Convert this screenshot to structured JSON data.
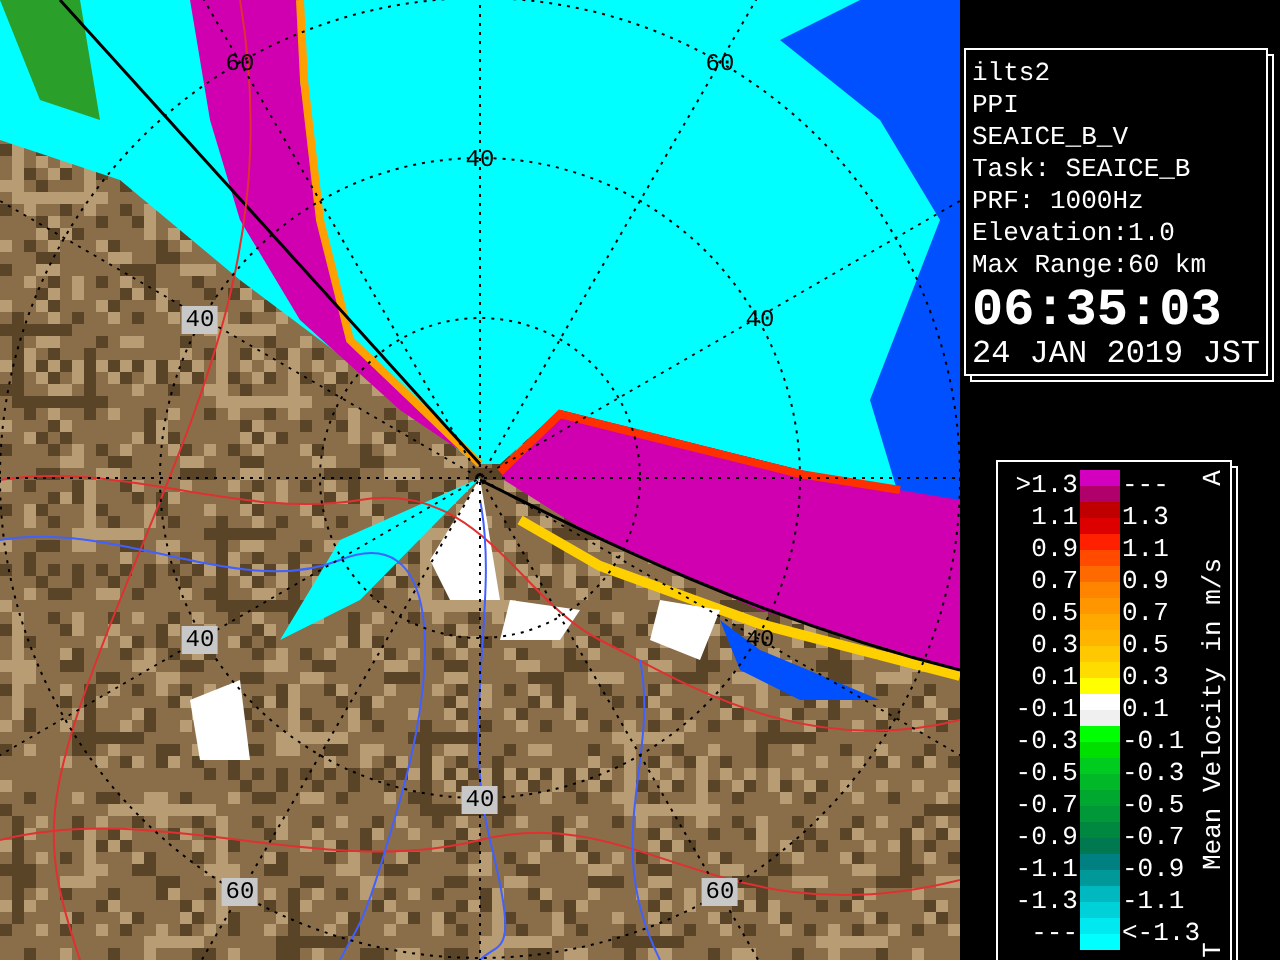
{
  "map": {
    "range_labels": [
      {
        "text": "60",
        "kind": "plain"
      },
      {
        "text": "60",
        "kind": "plain"
      },
      {
        "text": "40",
        "kind": "plain"
      },
      {
        "text": "40",
        "kind": "boxed"
      },
      {
        "text": "40",
        "kind": "plain"
      },
      {
        "text": "40",
        "kind": "boxed"
      },
      {
        "text": "40",
        "kind": "plain"
      },
      {
        "text": "40",
        "kind": "boxed"
      },
      {
        "text": "60",
        "kind": "boxed"
      },
      {
        "text": "60",
        "kind": "boxed"
      }
    ]
  },
  "info": {
    "lines": [
      "ilts2",
      "PPI",
      "SEAICE_B_V",
      "Task: SEAICE_B",
      "PRF: 1000Hz",
      "Elevation:1.0",
      "Max Range:60 km"
    ],
    "time": "06:35:03",
    "date": "24 JAN 2019 JST"
  },
  "legend": {
    "top_mark": "A",
    "title": "Mean Velocity in m/s",
    "bottom_mark": "T",
    "left_labels": [
      ">1.3",
      "1.1",
      "0.9",
      "0.7",
      "0.5",
      "0.3",
      "0.1",
      "-0.1",
      "-0.3",
      "-0.5",
      "-0.7",
      "-0.9",
      "-1.1",
      "-1.3",
      "---"
    ],
    "right_labels": [
      "---",
      "1.3",
      "1.1",
      "0.9",
      "0.7",
      "0.5",
      "0.3",
      "0.1",
      "-0.1",
      "-0.3",
      "-0.5",
      "-0.7",
      "-0.9",
      "-1.1",
      "<-1.3"
    ],
    "swatches": [
      {
        "color": "#d400c0"
      },
      {
        "color": "#b0006a"
      },
      {
        "color": "#c00000"
      },
      {
        "color": "#dc0000"
      },
      {
        "color": "#ff2000"
      },
      {
        "color": "#ff4a00"
      },
      {
        "color": "#ff6a00"
      },
      {
        "color": "#ff8400"
      },
      {
        "color": "#ff9600"
      },
      {
        "color": "#ffa800"
      },
      {
        "color": "#ffb400"
      },
      {
        "color": "#ffc800"
      },
      {
        "color": "#ffdc00"
      },
      {
        "color": "#ffff00"
      },
      {
        "color": "#ffffff"
      },
      {
        "color": "#f0f0f0"
      },
      {
        "color": "#00ff00"
      },
      {
        "color": "#00e000"
      },
      {
        "color": "#00cc20"
      },
      {
        "color": "#00b828"
      },
      {
        "color": "#00a830"
      },
      {
        "color": "#009838"
      },
      {
        "color": "#008840"
      },
      {
        "color": "#007850"
      },
      {
        "color": "#008080"
      },
      {
        "color": "#009898"
      },
      {
        "color": "#00b8c0"
      },
      {
        "color": "#00d0d8"
      },
      {
        "color": "#00e8f0"
      },
      {
        "color": "#00ffff"
      }
    ]
  }
}
